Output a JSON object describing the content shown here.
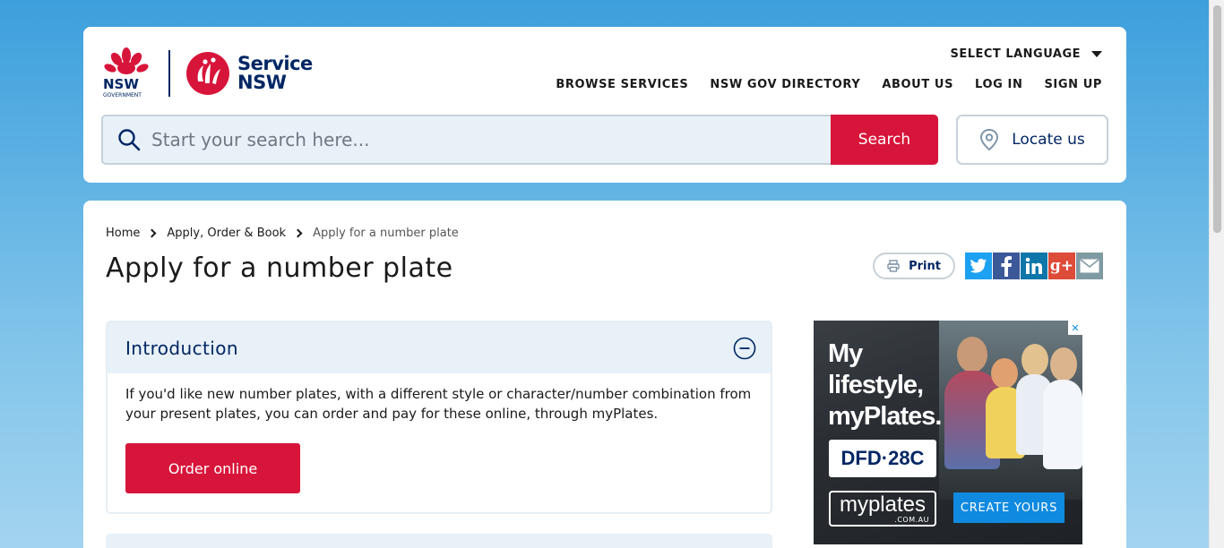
{
  "header": {
    "logo_nsw_text": "NSW",
    "logo_gov_text": "GOVERNMENT",
    "logo_service_line1": "Service",
    "logo_service_line2": "NSW",
    "language_label": "SELECT LANGUAGE",
    "nav": [
      {
        "label": "BROWSE SERVICES"
      },
      {
        "label": "NSW GOV DIRECTORY"
      },
      {
        "label": "ABOUT US"
      },
      {
        "label": "LOG IN"
      },
      {
        "label": "SIGN UP"
      }
    ],
    "search": {
      "placeholder": "Start your search here...",
      "button_label": "Search"
    },
    "locate_label": "Locate us"
  },
  "breadcrumb": [
    {
      "label": "Home"
    },
    {
      "label": "Apply, Order & Book"
    },
    {
      "label": "Apply for a number plate"
    }
  ],
  "page_title": "Apply for a number plate",
  "print_label": "Print",
  "share": {
    "twitter": "twitter-icon",
    "facebook": "facebook-icon",
    "linkedin": "linkedin-icon",
    "googleplus": "googleplus-icon",
    "email": "email-icon",
    "colors": {
      "twitter": "#1da1f2",
      "facebook": "#3b5998",
      "linkedin": "#0e76a8",
      "googleplus": "#dd4b39",
      "email": "#7f9aa3"
    }
  },
  "accordion": {
    "title": "Introduction",
    "body": "If you'd like new number plates, with a different style or character/number combination from your present plates, you can order and pay for these online, through myPlates.",
    "button_label": "Order online"
  },
  "ad": {
    "headline_1": "My",
    "headline_2": "lifestyle,",
    "headline_3": "myPlates.",
    "plate_text": "DFD·28C",
    "logo_main": "myplates",
    "logo_sub": ".COM.AU",
    "cta": "CREATE YOURS"
  },
  "colors": {
    "brand_red": "#d7153a",
    "brand_navy": "#002664",
    "accent_blue": "#0f8ae0"
  }
}
